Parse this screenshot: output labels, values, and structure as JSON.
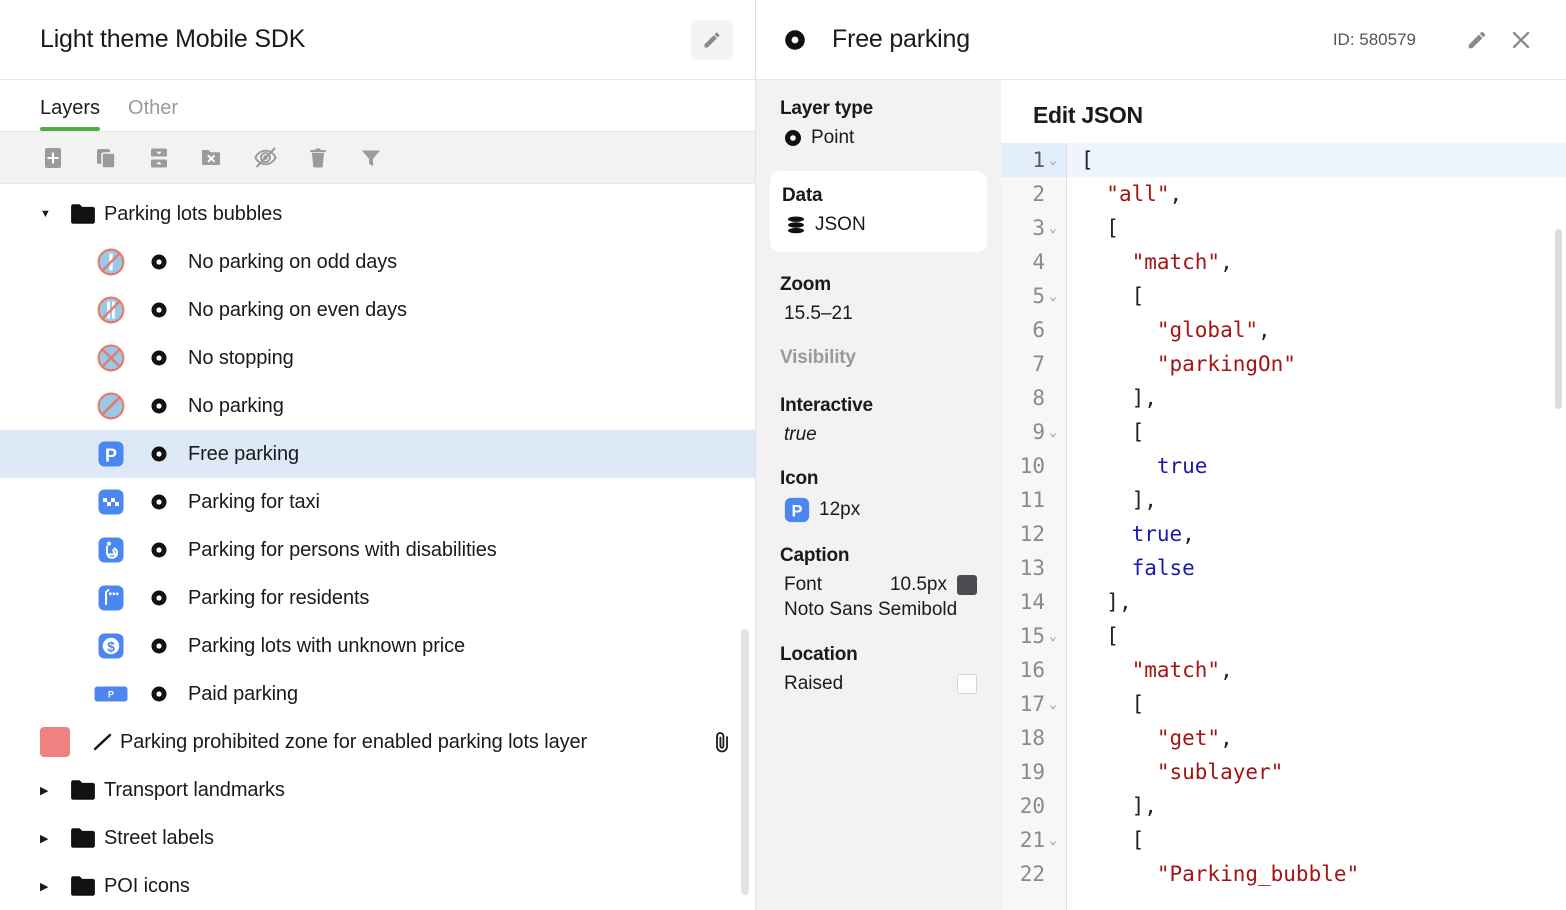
{
  "left": {
    "project_title": "Light theme Mobile SDK",
    "edit_icon": "pencil-icon",
    "tabs": [
      {
        "label": "Layers",
        "active": true
      },
      {
        "label": "Other",
        "active": false
      }
    ],
    "toolbar": [
      {
        "name": "add-layer-button",
        "icon": "plus-square-icon"
      },
      {
        "name": "duplicate-layer-button",
        "icon": "copy-icon"
      },
      {
        "name": "sort-layers-button",
        "icon": "sort-updown-icon"
      },
      {
        "name": "delete-folder-button",
        "icon": "folder-x-icon"
      },
      {
        "name": "hide-layer-button",
        "icon": "eye-off-icon"
      },
      {
        "name": "delete-layer-button",
        "icon": "trash-icon"
      },
      {
        "name": "filter-layers-button",
        "icon": "filter-icon"
      }
    ],
    "layers": [
      {
        "label": "Parking lots bubbles",
        "kind": "group",
        "expanded": true,
        "twisty": "▼"
      },
      {
        "label": "No parking on odd days",
        "kind": "point",
        "icon": "sign-no-parking-odd-icon"
      },
      {
        "label": "No parking on even days",
        "kind": "point",
        "icon": "sign-no-parking-even-icon"
      },
      {
        "label": "No stopping",
        "kind": "point",
        "icon": "sign-no-stopping-icon"
      },
      {
        "label": "No parking",
        "kind": "point",
        "icon": "sign-no-parking-icon"
      },
      {
        "label": "Free parking",
        "kind": "point",
        "icon": "parking-p-icon",
        "selected": true
      },
      {
        "label": "Parking for taxi",
        "kind": "point",
        "icon": "parking-taxi-icon"
      },
      {
        "label": "Parking for persons with disabilities",
        "kind": "point",
        "icon": "parking-accessible-icon"
      },
      {
        "label": "Parking for residents",
        "kind": "point",
        "icon": "parking-residents-icon"
      },
      {
        "label": "Parking lots with unknown price",
        "kind": "point",
        "icon": "parking-unknown-price-icon"
      },
      {
        "label": "Paid parking",
        "kind": "point",
        "icon": "parking-paid-icon"
      },
      {
        "label": "Parking prohibited zone for enabled parking lots layer",
        "kind": "line",
        "swatch": "#ef8181",
        "attachment": "paperclip-icon"
      },
      {
        "label": "Transport landmarks",
        "kind": "group",
        "expanded": false,
        "twisty": "▶"
      },
      {
        "label": "Street labels",
        "kind": "group",
        "expanded": false,
        "twisty": "▶"
      },
      {
        "label": "POI icons",
        "kind": "group",
        "expanded": false,
        "twisty": "▶"
      }
    ]
  },
  "right": {
    "header": {
      "type_icon": "point-icon",
      "title": "Free parking",
      "id_text": "ID: 580579",
      "edit_icon": "pencil-icon",
      "close_icon": "close-icon"
    },
    "properties": {
      "layer_type_label": "Layer type",
      "layer_type_value": "Point",
      "data_label": "Data",
      "data_value": "JSON",
      "data_icon": "database-icon",
      "zoom_label": "Zoom",
      "zoom_value": "15.5–21",
      "visibility_label": "Visibility",
      "interactive_label": "Interactive",
      "interactive_value": "true",
      "icon_label": "Icon",
      "icon_size": "12px",
      "icon_glyph": "parking-p-icon",
      "caption_label": "Caption",
      "caption_font_label": "Font",
      "caption_font_size": "10.5px",
      "caption_font_color": "#4a4a4f",
      "caption_font_name": "Noto Sans Semibold",
      "location_label": "Location",
      "location_value": "Raised",
      "location_color": "#ffffff"
    },
    "json_editor": {
      "title": "Edit JSON",
      "current_line": 1,
      "lines": [
        {
          "n": 1,
          "fold": true,
          "indent": 0,
          "tokens": [
            {
              "t": "[",
              "c": "p"
            }
          ]
        },
        {
          "n": 2,
          "fold": false,
          "indent": 1,
          "tokens": [
            {
              "t": "\"all\"",
              "c": "s"
            },
            {
              "t": ",",
              "c": "p"
            }
          ]
        },
        {
          "n": 3,
          "fold": true,
          "indent": 1,
          "tokens": [
            {
              "t": "[",
              "c": "p"
            }
          ]
        },
        {
          "n": 4,
          "fold": false,
          "indent": 2,
          "tokens": [
            {
              "t": "\"match\"",
              "c": "s"
            },
            {
              "t": ",",
              "c": "p"
            }
          ]
        },
        {
          "n": 5,
          "fold": true,
          "indent": 2,
          "tokens": [
            {
              "t": "[",
              "c": "p"
            }
          ]
        },
        {
          "n": 6,
          "fold": false,
          "indent": 3,
          "tokens": [
            {
              "t": "\"global\"",
              "c": "s"
            },
            {
              "t": ",",
              "c": "p"
            }
          ]
        },
        {
          "n": 7,
          "fold": false,
          "indent": 3,
          "tokens": [
            {
              "t": "\"parkingOn\"",
              "c": "s"
            }
          ]
        },
        {
          "n": 8,
          "fold": false,
          "indent": 2,
          "tokens": [
            {
              "t": "],",
              "c": "p"
            }
          ]
        },
        {
          "n": 9,
          "fold": true,
          "indent": 2,
          "tokens": [
            {
              "t": "[",
              "c": "p"
            }
          ]
        },
        {
          "n": 10,
          "fold": false,
          "indent": 3,
          "tokens": [
            {
              "t": "true",
              "c": "b"
            }
          ]
        },
        {
          "n": 11,
          "fold": false,
          "indent": 2,
          "tokens": [
            {
              "t": "],",
              "c": "p"
            }
          ]
        },
        {
          "n": 12,
          "fold": false,
          "indent": 2,
          "tokens": [
            {
              "t": "true",
              "c": "b"
            },
            {
              "t": ",",
              "c": "p"
            }
          ]
        },
        {
          "n": 13,
          "fold": false,
          "indent": 2,
          "tokens": [
            {
              "t": "false",
              "c": "b"
            }
          ]
        },
        {
          "n": 14,
          "fold": false,
          "indent": 1,
          "tokens": [
            {
              "t": "],",
              "c": "p"
            }
          ]
        },
        {
          "n": 15,
          "fold": true,
          "indent": 1,
          "tokens": [
            {
              "t": "[",
              "c": "p"
            }
          ]
        },
        {
          "n": 16,
          "fold": false,
          "indent": 2,
          "tokens": [
            {
              "t": "\"match\"",
              "c": "s"
            },
            {
              "t": ",",
              "c": "p"
            }
          ]
        },
        {
          "n": 17,
          "fold": true,
          "indent": 2,
          "tokens": [
            {
              "t": "[",
              "c": "p"
            }
          ]
        },
        {
          "n": 18,
          "fold": false,
          "indent": 3,
          "tokens": [
            {
              "t": "\"get\"",
              "c": "s"
            },
            {
              "t": ",",
              "c": "p"
            }
          ]
        },
        {
          "n": 19,
          "fold": false,
          "indent": 3,
          "tokens": [
            {
              "t": "\"sublayer\"",
              "c": "s"
            }
          ]
        },
        {
          "n": 20,
          "fold": false,
          "indent": 2,
          "tokens": [
            {
              "t": "],",
              "c": "p"
            }
          ]
        },
        {
          "n": 21,
          "fold": true,
          "indent": 2,
          "tokens": [
            {
              "t": "[",
              "c": "p"
            }
          ]
        },
        {
          "n": 22,
          "fold": false,
          "indent": 3,
          "tokens": [
            {
              "t": "\"Parking_bubble\"",
              "c": "s"
            }
          ]
        }
      ]
    }
  },
  "colors": {
    "accent_green": "#4caf3f",
    "selection_blue": "#dde9f7",
    "icon_blue": "#4c86f0",
    "sign_red": "#e8796b",
    "sign_blue": "#9ac8e8",
    "zone_red": "#ef8181"
  }
}
